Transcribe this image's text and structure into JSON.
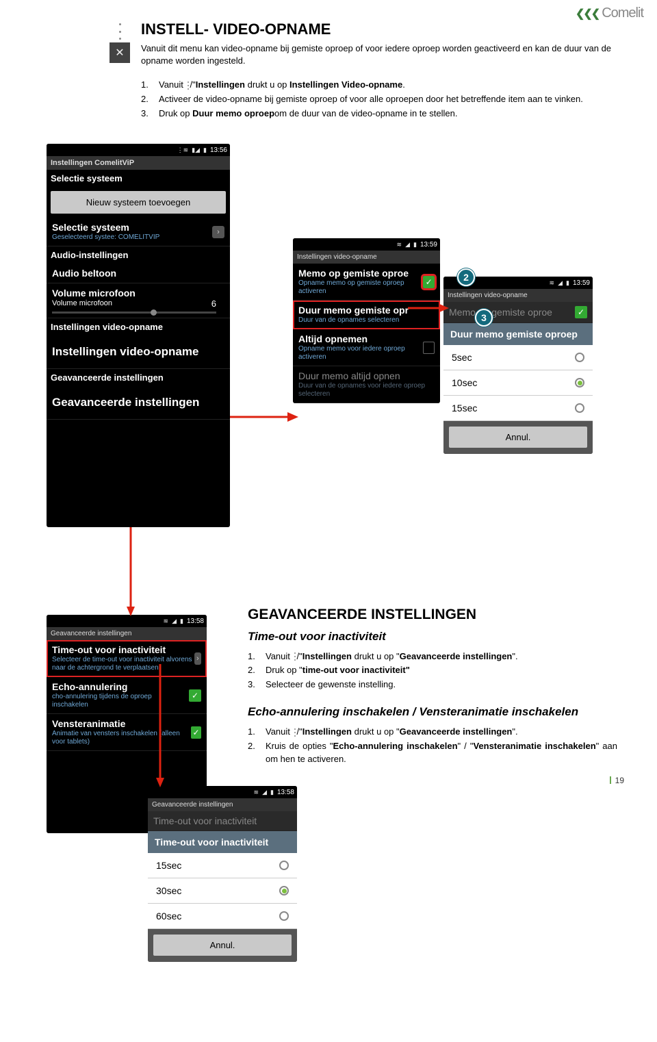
{
  "logo": {
    "brand": "Comelit"
  },
  "section1": {
    "title": "INSTELL- VIDEO-OPNAME",
    "intro": "Vanuit dit menu kan video-opname bij gemiste oproep of voor iedere oproep worden geactiveerd en kan de duur van de opname worden ingesteld.",
    "steps": [
      {
        "n": "1.",
        "text": "Vanuit  /\"Instellingen drukt u op Instellingen Video-opname."
      },
      {
        "n": "2.",
        "text": "Activeer de video-opname bij gemiste oproep of voor alle oproepen door het betreffende item aan te vinken."
      },
      {
        "n": "3.",
        "text": "Druk op Duur memo oproepom de duur van de video-opname in te stellen."
      }
    ]
  },
  "section2": {
    "title": "GEAVANCEERDE INSTELLINGEN",
    "sub1": "Time-out voor inactiviteit",
    "steps1": [
      {
        "n": "1.",
        "text": "Vanuit  /\"Instellingen drukt u op \"Geavanceerde instellingen\"."
      },
      {
        "n": "2.",
        "text": "Druk op \"time-out voor inactiviteit\""
      },
      {
        "n": "3.",
        "text": "Selecteer de gewenste instelling."
      }
    ],
    "sub2": "Echo-annulering inschakelen / Vensteranimatie inschakelen",
    "steps2": [
      {
        "n": "1.",
        "text": "Vanuit  /\"Instellingen drukt u op \"Geavanceerde instellingen\"."
      },
      {
        "n": "2.",
        "text": "Kruis de opties \"Echo-annulering inschakelen\" / \"Vensteranimatie inschakelen\" aan om hen te activeren."
      }
    ]
  },
  "phone_main": {
    "time": "13:56",
    "title": "Instellingen ComelitViP",
    "g1": "Selectie systeem",
    "btn1": "Nieuw systeem toevoegen",
    "r1t": "Selectie systeem",
    "r1s": "Geselecteerd systee: COMELITVIP",
    "g2": "Audio-instellingen",
    "r2t": "Audio beltoon",
    "r3t": "Volume microfoon",
    "r3s": "Volume microfoon",
    "r3v": "6",
    "g3": "Instellingen video-opname",
    "r4t": "Instellingen video-opname",
    "g4": "Geavanceerde instellingen",
    "r5t": "Geavanceerde instellingen"
  },
  "phone_video": {
    "time": "13:59",
    "title": "Instellingen video-opname",
    "r1t": "Memo op gemiste oproe",
    "r1s": "Opname memo op gemiste oproep activeren",
    "r2t": "Duur memo gemiste opr",
    "r2s": "Duur van de opnames selecteren",
    "r3t": "Altijd opnemen",
    "r3s": "Opname memo voor iedere oproep activeren",
    "r4t": "Duur memo altijd opnen",
    "r4s": "Duur van de opnames voor iedere oproep selecteren"
  },
  "phone_duur": {
    "time": "13:59",
    "title": "Instellingen video-opname",
    "r1t": "Memo op gemiste oproe",
    "dlg": "Duur memo gemiste oproep",
    "o1": "5sec",
    "o2": "10sec",
    "o3": "15sec",
    "cancel": "Annul."
  },
  "phone_adv": {
    "time": "13:58",
    "title": "Geavanceerde instellingen",
    "r1t": "Time-out voor inactiviteit",
    "r1s": "Selecteer de time-out voor inactiviteit alvorens naar de achtergrond te verplaatsen",
    "r2t": "Echo-annulering",
    "r2s": "cho-annulering tijdens de oproep inschakelen",
    "r3t": "Vensteranimatie",
    "r3s": "Animatie van vensters inschakelen (alleen voor tablets)"
  },
  "phone_timeout": {
    "time": "13:58",
    "title": "Geavanceerde instellingen",
    "rt": "Time-out voor inactiviteit",
    "dlg": "Time-out voor inactiviteit",
    "o1": "15sec",
    "o2": "30sec",
    "o3": "60sec",
    "cancel": "Annul."
  },
  "callouts": {
    "c2": "2",
    "c3": "3"
  },
  "pagenum": "19"
}
